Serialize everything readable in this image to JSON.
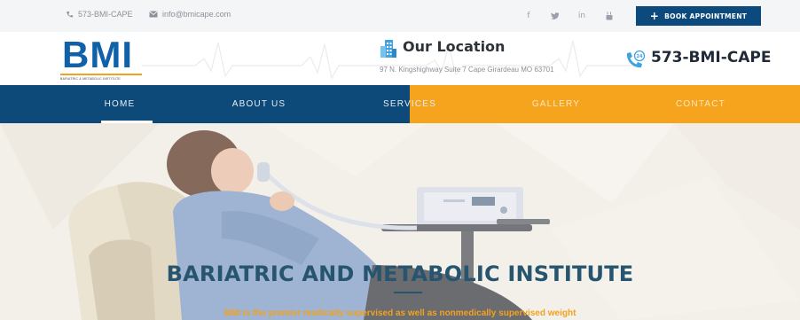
{
  "topbar": {
    "phone": "573-BMI-CAPE",
    "email": "info@bmicape.com",
    "book_label": "BOOK APPOINTMENT",
    "social_icons": [
      "facebook-icon",
      "twitter-icon",
      "linkedin-icon",
      "youtube-icon"
    ]
  },
  "header": {
    "logo_text": "BMI",
    "logo_subtitle": "BARIATRIC & METABOLIC INSTITUTE",
    "location_title": "Our Location",
    "location_address": "97 N. Kingshighway Suite 7 Cape Girardeau MO 63701",
    "phone_number": "573-BMI-CAPE"
  },
  "nav": {
    "items": [
      {
        "label": "HOME"
      },
      {
        "label": "ABOUT US"
      },
      {
        "label": "SERVICES"
      },
      {
        "label": "GALLERY"
      },
      {
        "label": "CONTACT"
      }
    ],
    "active": "HOME"
  },
  "hero": {
    "title": "BARIATRIC AND METABOLIC INSTITUTE",
    "subtitle": "BMI is the premier medically supervised as well as nonmedically supervised weight"
  },
  "colors": {
    "brand_blue": "#0d4a7a",
    "accent_orange": "#f6a31d",
    "logo_blue": "#1161a8",
    "hero_title": "#27556f"
  }
}
